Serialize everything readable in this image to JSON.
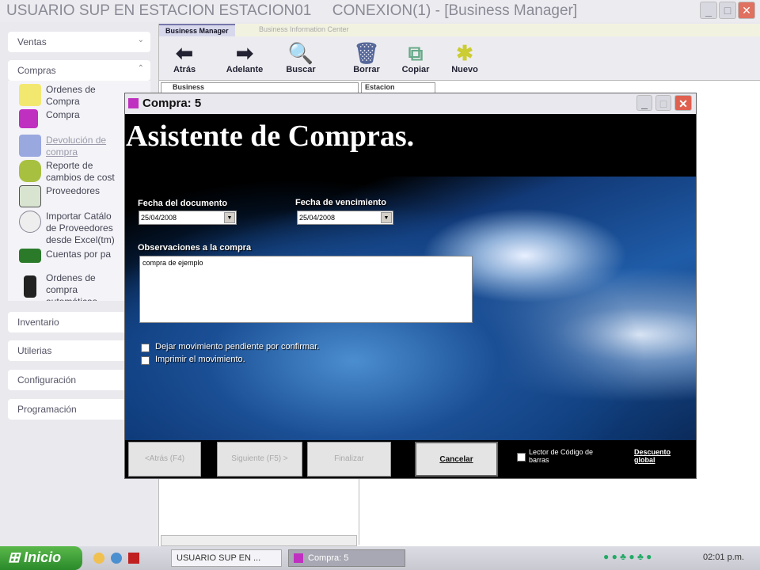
{
  "window": {
    "title": "USUARIO SUP EN ESTACION ESTACION01     CONEXION(1) - [Business Manager]"
  },
  "sidebar": {
    "sections": [
      {
        "label": "Ventas"
      },
      {
        "label": "Compras"
      },
      {
        "label": "Inventario"
      },
      {
        "label": "Utilerias"
      },
      {
        "label": "Configuración"
      },
      {
        "label": "Programación"
      }
    ],
    "items": [
      {
        "label": "Ordenes de\nCompra",
        "icon": "notepad-pin-icon"
      },
      {
        "label": "Compra",
        "icon": "purchase-check-icon"
      },
      {
        "label": "Devolución de\ncompra",
        "icon": "return-icon"
      },
      {
        "label": "Reporte de\ncambios de cost",
        "icon": "basket-icon"
      },
      {
        "label": "Proveedores",
        "icon": "suppliers-icon"
      },
      {
        "label": "Importar Catálo\nde Proveedores\ndesde Excel(tm)",
        "icon": "import-icon"
      },
      {
        "label": "Cuentas por pa",
        "icon": "money-icon"
      },
      {
        "label": "Ordenes de\ncompra\nautomáticas",
        "icon": "auto-order-icon"
      }
    ]
  },
  "main": {
    "tabs": [
      {
        "label": "Business Manager"
      },
      {
        "label": "Business Information Center"
      }
    ],
    "toolbar": [
      {
        "label": "Atrás",
        "icon": "◆"
      },
      {
        "label": "Adelante",
        "icon": "➡"
      },
      {
        "label": "Buscar",
        "icon": "🔍"
      },
      {
        "label": "Borrar",
        "icon": "🗑"
      },
      {
        "label": "Copiar",
        "icon": "⧉"
      },
      {
        "label": "Nuevo",
        "icon": "✱"
      }
    ],
    "pane_labels": [
      "Business",
      "Estacion"
    ]
  },
  "dialog": {
    "title": "Compra: 5",
    "header": "Asistente de Compras.",
    "fecha_doc_label": "Fecha del documento",
    "fecha_doc": "25/04/2008",
    "fecha_venc_label": "Fecha de vencimiento",
    "fecha_venc": "25/04/2008",
    "obs_label": "Observaciones a la compra",
    "obs_value": "compra de ejemplo",
    "check1": "Dejar movimiento pendiente por confirmar.",
    "check2": "Imprimir el movimiento.",
    "btn_back": "<Atrás (F4)",
    "btn_next": "Siguiente (F5) >",
    "btn_finish": "Finalizar",
    "btn_cancel": "Cancelar",
    "barcode": "Lector de Código de barras",
    "discount": "Descuento global"
  },
  "taskbar": {
    "start": "Inicio",
    "tasks": [
      "USUARIO SUP EN ...",
      "Compra: 5"
    ],
    "clock": "02:01 p.m."
  }
}
